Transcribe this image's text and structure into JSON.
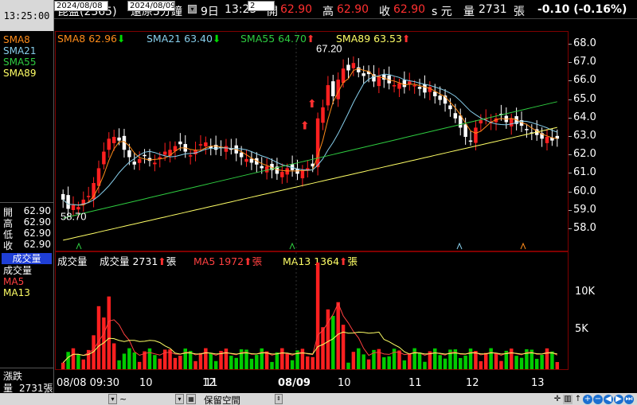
{
  "header": {
    "time": "13:25:00",
    "stock_name": "昆盈(2365)",
    "period": "還原5分鐘",
    "date": "9日",
    "bar_time": "13:25",
    "open_label": "開",
    "open": "62.90",
    "high_label": "高",
    "high": "62.90",
    "close_label": "收",
    "close": "62.90",
    "close_unit": "s 元",
    "volume_label": "量",
    "volume": "2731",
    "volume_unit": "張",
    "change": "-0.10 (-0.16%)"
  },
  "legend": {
    "sma8": "SMA8 62.96",
    "sma21": "SMA21 63.40",
    "sma55": "SMA55 64.70",
    "sma89": "SMA89 63.53",
    "vol": "成交量 2731",
    "vol_unit": "張",
    "ma5": "MA5 1972",
    "ma5_unit": "張",
    "ma13": "MA13 1364",
    "ma13_unit": "張",
    "vol_title": "成交量"
  },
  "left_panel": {
    "sma_labels": [
      "SMA8",
      "SMA21",
      "SMA55",
      "SMA89"
    ],
    "ohlc": [
      {
        "label": "開",
        "value": "62.90"
      },
      {
        "label": "高",
        "value": "62.90"
      },
      {
        "label": "低",
        "value": "62.90"
      },
      {
        "label": "收",
        "value": "62.90"
      }
    ],
    "vol_tab": "成交量",
    "vol_labels": [
      "成交量",
      "MA5",
      "MA13"
    ],
    "change_label": "漲跌",
    "vol_row_label": "量",
    "vol_row_value": "2731張"
  },
  "price_axis": [
    "68.0",
    "67.0",
    "66.0",
    "65.0",
    "64.0",
    "63.0",
    "62.0",
    "61.0",
    "60.0",
    "59.0",
    "58.0"
  ],
  "vol_axis": [
    "10K",
    "5K"
  ],
  "annotations": {
    "high": "67.20",
    "low": "58.70"
  },
  "x_axis": [
    {
      "label": "08/08 09:30",
      "bold": false
    },
    {
      "label": "10",
      "bold": false
    },
    {
      "label": "11",
      "bold": false
    },
    {
      "label": "12",
      "bold": false
    },
    {
      "label": "08/09",
      "bold": true
    },
    {
      "label": "10",
      "bold": false
    },
    {
      "label": "11",
      "bold": false
    },
    {
      "label": "12",
      "bold": false
    },
    {
      "label": "13",
      "bold": false
    }
  ],
  "bottom": {
    "start_date": "2024/08/08",
    "end_date": "2024/08/09",
    "space_label": "保留空間",
    "space_value": "2"
  },
  "colors": {
    "up": "#ff2020",
    "down": "#00cc00",
    "sma8": "#ff8c1a",
    "sma21": "#87ceeb",
    "sma55": "#2ecc40",
    "sma89": "#ffff66"
  }
}
